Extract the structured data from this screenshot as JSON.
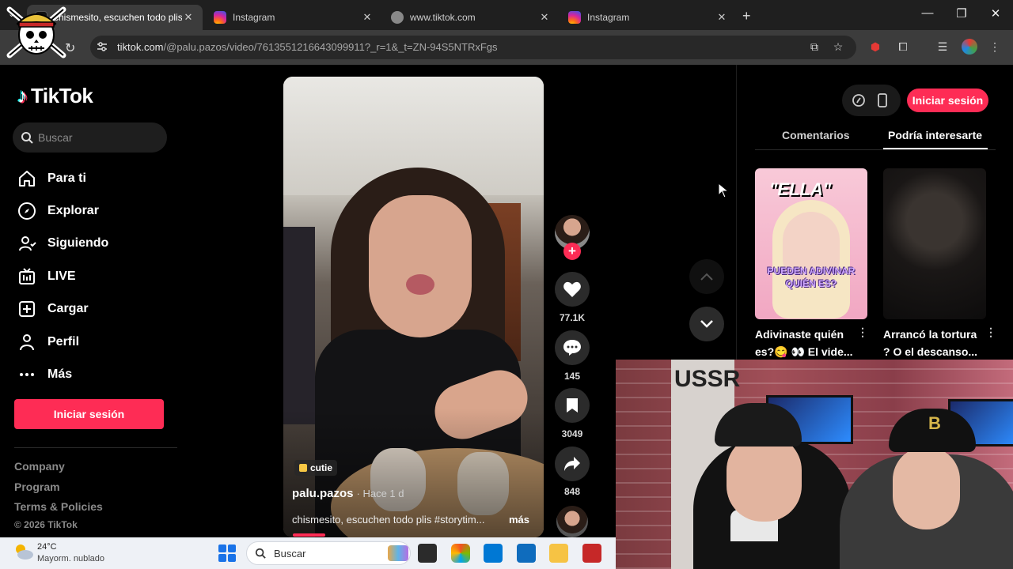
{
  "browser": {
    "tabs": [
      {
        "title": "chismesito, escuchen todo plis",
        "icon": "tiktok-icon",
        "active": true
      },
      {
        "title": "Instagram",
        "icon": "instagram-icon",
        "active": false
      },
      {
        "title": "www.tiktok.com",
        "icon": "globe-icon",
        "active": false
      },
      {
        "title": "Instagram",
        "icon": "instagram-icon",
        "active": false
      }
    ],
    "new_tab": "+",
    "url_host": "tiktok.com",
    "url_path": "/@palu.pazos/video/7613551216643099911?_r=1&_t=ZN-94S5NTRxFgs",
    "window": {
      "minimize": "—",
      "maximize": "❐",
      "close": "✕"
    }
  },
  "sidebar": {
    "logo": "TikTok",
    "search_placeholder": "Buscar",
    "nav": [
      {
        "label": "Para ti",
        "icon": "home-icon"
      },
      {
        "label": "Explorar",
        "icon": "compass-icon"
      },
      {
        "label": "Siguiendo",
        "icon": "following-icon"
      },
      {
        "label": "LIVE",
        "icon": "live-icon"
      },
      {
        "label": "Cargar",
        "icon": "upload-icon"
      },
      {
        "label": "Perfil",
        "icon": "profile-icon"
      },
      {
        "label": "Más",
        "icon": "more-icon"
      }
    ],
    "login_label": "Iniciar sesión",
    "footer_links": [
      "Company",
      "Program",
      "Terms & Policies"
    ],
    "copyright": "© 2026 TikTok"
  },
  "video": {
    "tag": "cutie",
    "username": "palu.pazos",
    "posted": "· Hace 1 d",
    "description": "chismesito, escuchen todo plis #storytim...",
    "more": "más",
    "progress": 0.13
  },
  "actions": {
    "likes": "77.1K",
    "comments": "145",
    "saves": "3049",
    "shares": "848"
  },
  "right_panel": {
    "login_label": "Iniciar sesión",
    "tabs": [
      "Comentarios",
      "Podría interesarte"
    ],
    "active_tab": "Podría interesarte",
    "recommendations": [
      {
        "title_line1": "Adivinaste quién",
        "title_line2": "es?😋 👀 El vide...",
        "overlay_top": "\"ELLA\"",
        "overlay_caption": "PUEDEN ADIVINAR QUIÉN ES?"
      },
      {
        "title_line1": "Arrancó la tortura",
        "title_line2": "? O el descanso...",
        "overlay_top": "",
        "overlay_caption": ""
      }
    ]
  },
  "webcam": {
    "sign": "USSR"
  },
  "taskbar": {
    "temperature": "24°C",
    "weather": "Mayorm. nublado",
    "search_placeholder": "Buscar"
  },
  "colors": {
    "accent": "#fe2c55",
    "background": "#000000",
    "panel": "#1e1e1e"
  }
}
